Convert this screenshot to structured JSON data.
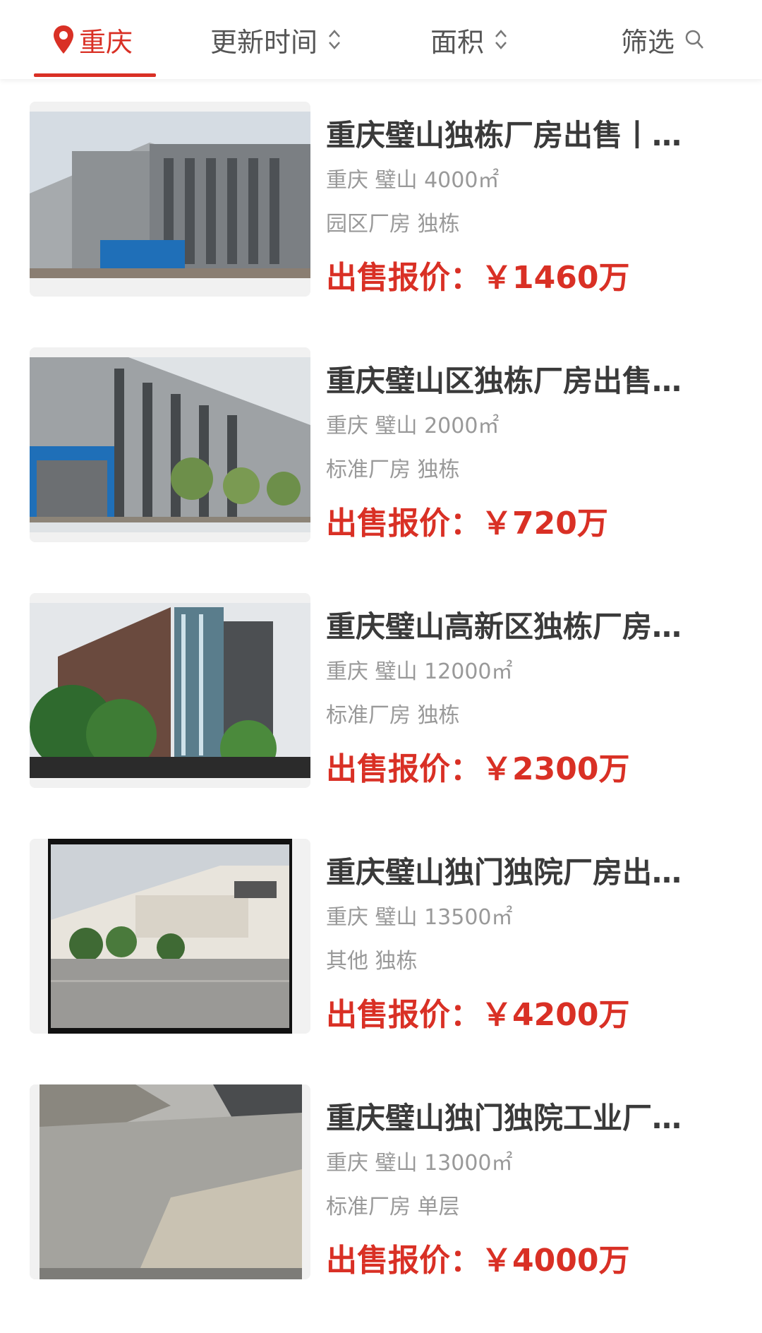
{
  "filters": {
    "city": "重庆",
    "update_time": "更新时间",
    "area": "面积",
    "filter": "筛选"
  },
  "listings": [
    {
      "title": "重庆璧山独栋厂房出售丨…",
      "meta": "重庆 璧山 4000㎡",
      "tags": "园区厂房 独栋",
      "price": "出售报价：￥1460万"
    },
    {
      "title": "重庆璧山区独栋厂房出售…",
      "meta": "重庆 璧山 2000㎡",
      "tags": "标准厂房 独栋",
      "price": "出售报价：￥720万"
    },
    {
      "title": "重庆璧山高新区独栋厂房…",
      "meta": "重庆 璧山 12000㎡",
      "tags": "标准厂房 独栋",
      "price": "出售报价：￥2300万"
    },
    {
      "title": "重庆璧山独门独院厂房出…",
      "meta": "重庆 璧山 13500㎡",
      "tags": "其他 独栋",
      "price": "出售报价：￥4200万"
    },
    {
      "title": "重庆璧山独门独院工业厂…",
      "meta": "重庆 璧山 13000㎡",
      "tags": "标准厂房 单层",
      "price": "出售报价：￥4000万"
    }
  ],
  "colors": {
    "accent": "#d93025",
    "title": "#3a3a3a",
    "meta": "#999999"
  },
  "icons": {
    "city": "location-pin-icon",
    "sort": "sort-arrows-icon",
    "filter": "search-icon"
  }
}
